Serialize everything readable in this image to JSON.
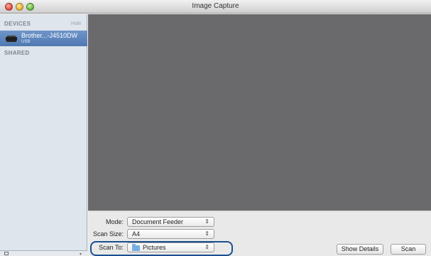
{
  "window": {
    "title": "Image Capture"
  },
  "sidebar": {
    "devices_heading": "DEVICES",
    "hide_label": "Hide",
    "device": {
      "name": "Brother...-J4510DW",
      "connection": "USB"
    },
    "shared_heading": "SHARED"
  },
  "controls": {
    "mode": {
      "label": "Mode:",
      "value": "Document Feeder"
    },
    "scan_size": {
      "label": "Scan Size:",
      "value": "A4"
    },
    "scan_to": {
      "label": "Scan To:",
      "value": "Pictures"
    },
    "show_details_label": "Show Details",
    "scan_label": "Scan"
  },
  "icons": {
    "device": "scanner-icon",
    "folder": "folder-icon",
    "popup": "chevron-updown-icon"
  },
  "colors": {
    "selection": "#4f79b3",
    "preview_bg": "#6a6a6c",
    "highlight": "#1c4f8f"
  }
}
